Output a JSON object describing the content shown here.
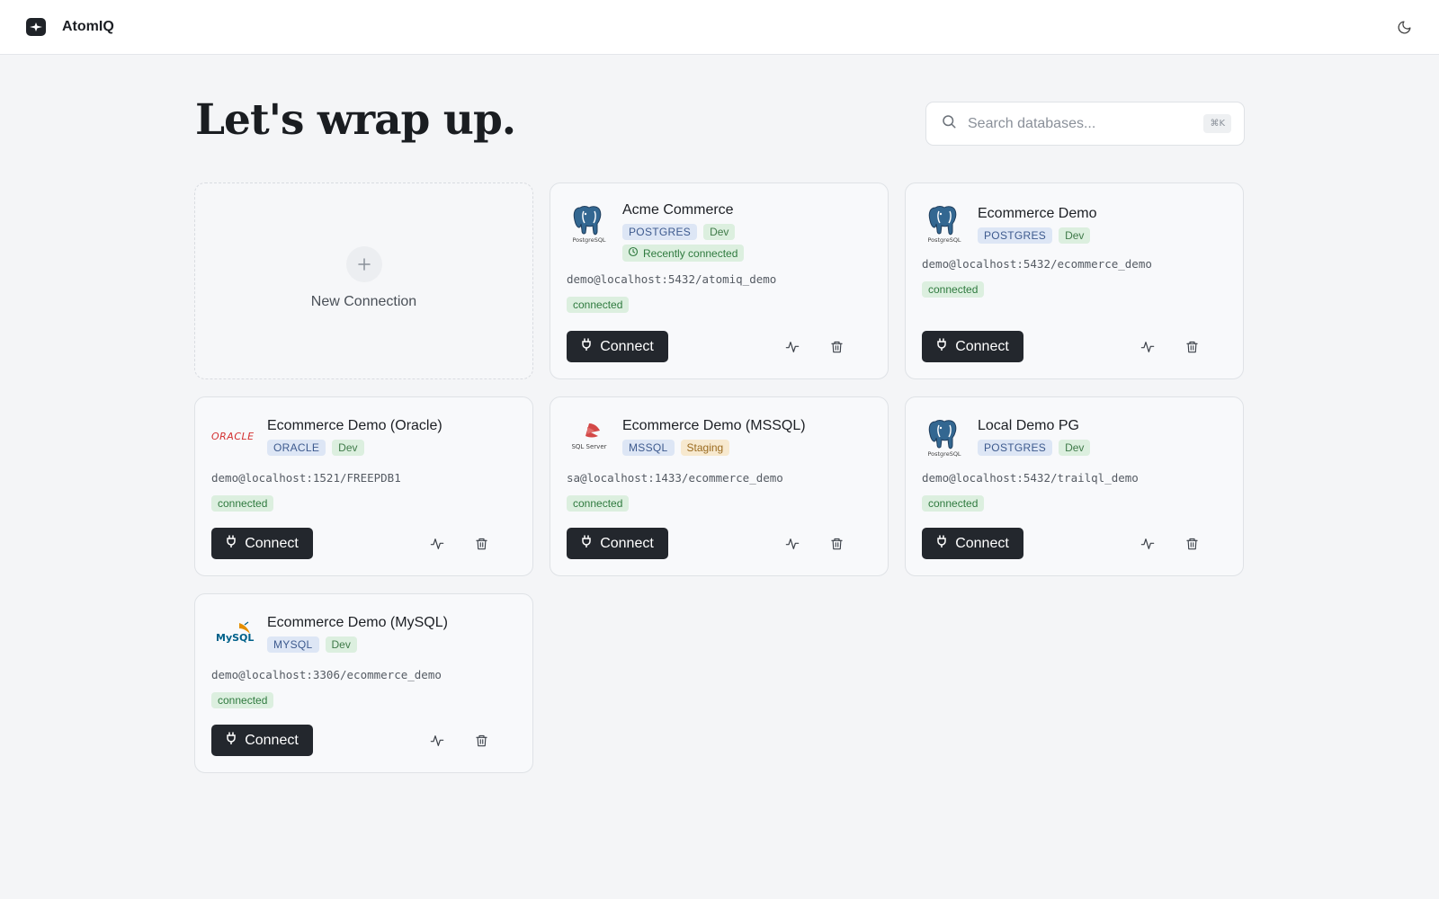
{
  "header": {
    "app_title": "AtomIQ"
  },
  "page": {
    "heading": "Let's wrap up."
  },
  "search": {
    "placeholder": "Search databases...",
    "shortcut": "⌘K"
  },
  "new_connection": {
    "label": "New Connection"
  },
  "connections": [
    {
      "name": "Acme Commerce",
      "type": "POSTGRES",
      "env": "Dev",
      "recent": "Recently connected",
      "conn": "demo@localhost:5432/atomiq_demo",
      "status": "connected",
      "connect_label": "Connect",
      "logo": "postgresql-logo"
    },
    {
      "name": "Ecommerce Demo",
      "type": "POSTGRES",
      "env": "Dev",
      "conn": "demo@localhost:5432/ecommerce_demo",
      "status": "connected",
      "connect_label": "Connect",
      "logo": "postgresql-logo"
    },
    {
      "name": "Ecommerce Demo (Oracle)",
      "type": "ORACLE",
      "env": "Dev",
      "conn": "demo@localhost:1521/FREEPDB1",
      "status": "connected",
      "connect_label": "Connect",
      "logo": "oracle-logo",
      "logo_text": "ORACLE"
    },
    {
      "name": "Ecommerce Demo (MSSQL)",
      "type": "MSSQL",
      "env": "Staging",
      "conn": "sa@localhost:1433/ecommerce_demo",
      "status": "connected",
      "connect_label": "Connect",
      "logo": "sql-server-logo",
      "logo_text": "SQL Server"
    },
    {
      "name": "Local Demo PG",
      "type": "POSTGRES",
      "env": "Dev",
      "conn": "demo@localhost:5432/trailql_demo",
      "status": "connected",
      "connect_label": "Connect",
      "logo": "postgresql-logo"
    },
    {
      "name": "Ecommerce Demo (MySQL)",
      "type": "MYSQL",
      "env": "Dev",
      "conn": "demo@localhost:3306/ecommerce_demo",
      "status": "connected",
      "connect_label": "Connect",
      "logo": "mysql-logo",
      "logo_text": "MySQL"
    }
  ],
  "colors": {
    "accent_dark": "#23272d",
    "status_green": "#2f7a3f",
    "type_blue": "#3d5a8e",
    "staging_amber": "#9a6a1e",
    "background": "#f4f5f7"
  }
}
